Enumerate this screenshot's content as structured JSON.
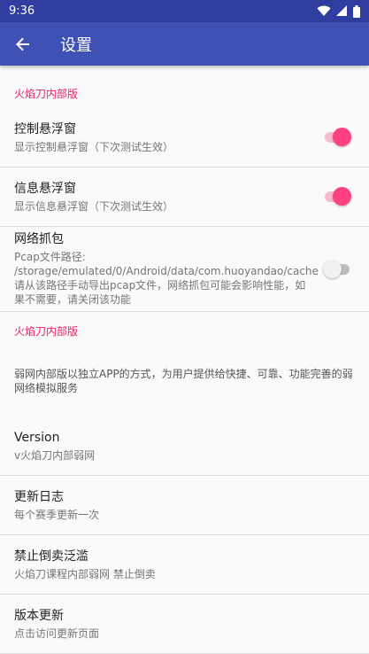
{
  "status_bar": {
    "time": "9:36"
  },
  "app_bar": {
    "title": "设置"
  },
  "section1": {
    "header": "火焰刀内部版"
  },
  "float_control": {
    "title": "控制悬浮窗",
    "summary": "显示控制悬浮窗（下次测试生效）",
    "enabled": true
  },
  "float_info": {
    "title": "信息悬浮窗",
    "summary": "显示信息悬浮窗（下次测试生效）",
    "enabled": true
  },
  "capture": {
    "title": "网络抓包",
    "summary": "Pcap文件路径: /storage/emulated/0/Android/data/com.huoyandao/cache 请从该路径手动导出pcap文件，网络抓包可能会影响性能，如果不需要，请关闭该功能",
    "enabled": false
  },
  "section2": {
    "header": "火焰刀内部版",
    "description": "弱网内部版以独立APP的方式，为用户提供给快捷、可靠、功能完善的弱网络模拟服务"
  },
  "version": {
    "title": "Version",
    "summary": "v火焰刀内部弱网"
  },
  "changelog": {
    "title": "更新日志",
    "summary": "每个赛季更新一次"
  },
  "no_resale": {
    "title": "禁止倒卖泛滥",
    "summary": "火焰刀课程内部弱网 禁止倒卖"
  },
  "update": {
    "title": "版本更新",
    "summary": "点击访问更新页面"
  },
  "colors": {
    "primary": "#3f51b5",
    "primary_dark": "#2f3e9e",
    "accent": "#ff4081"
  },
  "icons": {
    "back": "arrow-left-icon",
    "wifi": "wifi-icon",
    "signal": "signal-icon",
    "battery": "battery-icon"
  }
}
